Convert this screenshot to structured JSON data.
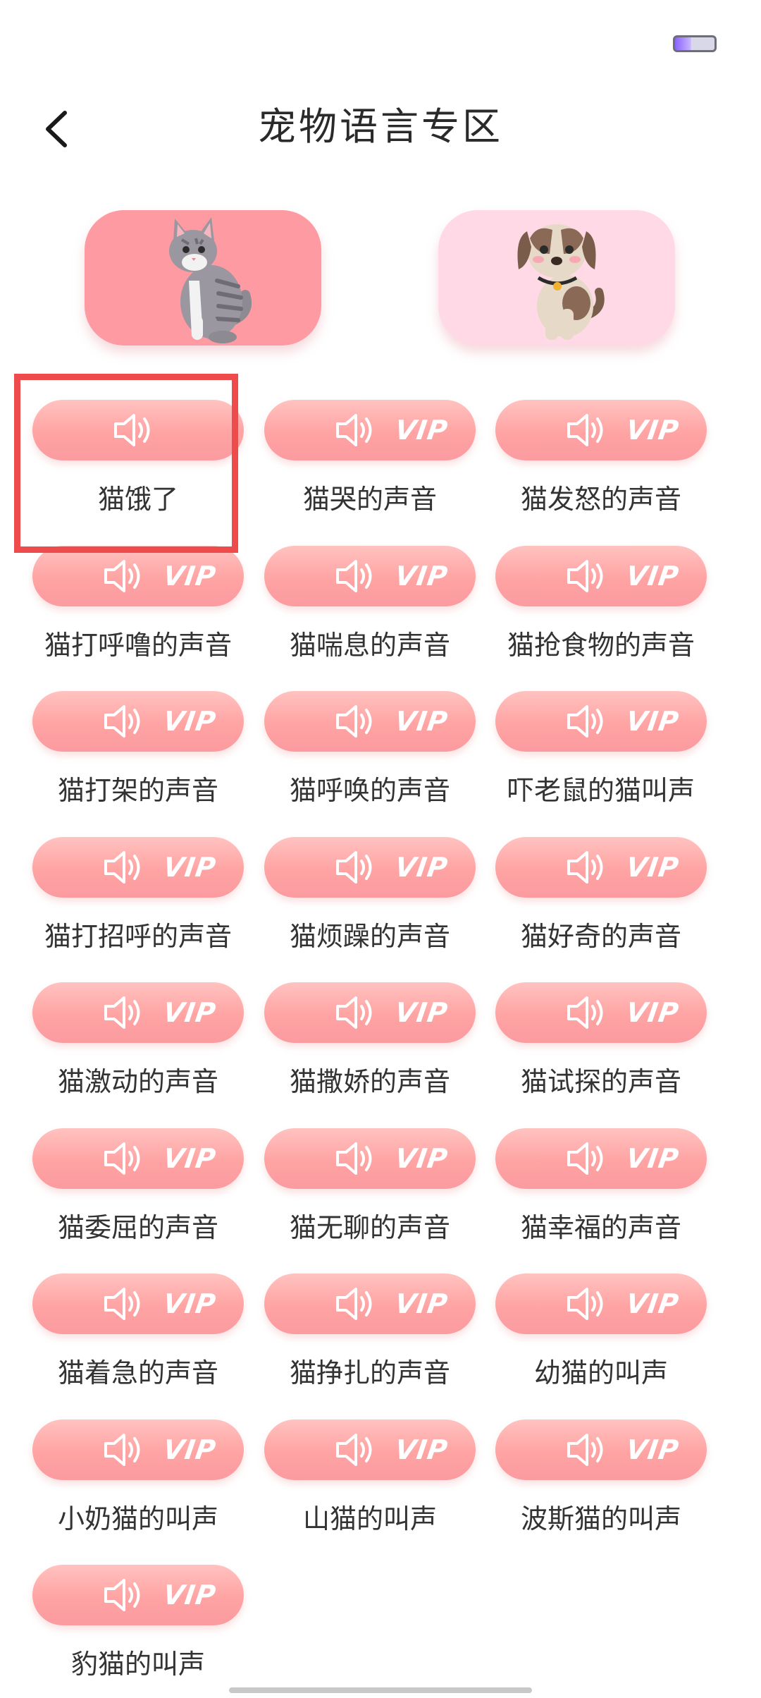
{
  "header": {
    "title": "宠物语言专区",
    "back_icon": "chevron-left-icon"
  },
  "tabs": [
    {
      "name": "cat",
      "icon": "cat-illustration",
      "selected": true,
      "color": "#fd9aa2"
    },
    {
      "name": "dog",
      "icon": "dog-illustration",
      "selected": false,
      "color": "#ffd9e6"
    }
  ],
  "badge_text": "VIP",
  "sounds": [
    {
      "label": "猫饿了",
      "vip": false
    },
    {
      "label": "猫哭的声音",
      "vip": true
    },
    {
      "label": "猫发怒的声音",
      "vip": true
    },
    {
      "label": "猫打呼噜的声音",
      "vip": true
    },
    {
      "label": "猫喘息的声音",
      "vip": true
    },
    {
      "label": "猫抢食物的声音",
      "vip": true
    },
    {
      "label": "猫打架的声音",
      "vip": true
    },
    {
      "label": "猫呼唤的声音",
      "vip": true
    },
    {
      "label": "吓老鼠的猫叫声",
      "vip": true
    },
    {
      "label": "猫打招呼的声音",
      "vip": true
    },
    {
      "label": "猫烦躁的声音",
      "vip": true
    },
    {
      "label": "猫好奇的声音",
      "vip": true
    },
    {
      "label": "猫激动的声音",
      "vip": true
    },
    {
      "label": "猫撒娇的声音",
      "vip": true
    },
    {
      "label": "猫试探的声音",
      "vip": true
    },
    {
      "label": "猫委屈的声音",
      "vip": true
    },
    {
      "label": "猫无聊的声音",
      "vip": true
    },
    {
      "label": "猫幸福的声音",
      "vip": true
    },
    {
      "label": "猫着急的声音",
      "vip": true
    },
    {
      "label": "猫挣扎的声音",
      "vip": true
    },
    {
      "label": "幼猫的叫声",
      "vip": true
    },
    {
      "label": "小奶猫的叫声",
      "vip": true
    },
    {
      "label": "山猫的叫声",
      "vip": true
    },
    {
      "label": "波斯猫的叫声",
      "vip": true
    },
    {
      "label": "豹猫的叫声",
      "vip": true
    }
  ],
  "colors": {
    "pill_top": "#ffc3c0",
    "pill_bottom": "#fb9ba0",
    "highlight": "#ee4c4c"
  }
}
